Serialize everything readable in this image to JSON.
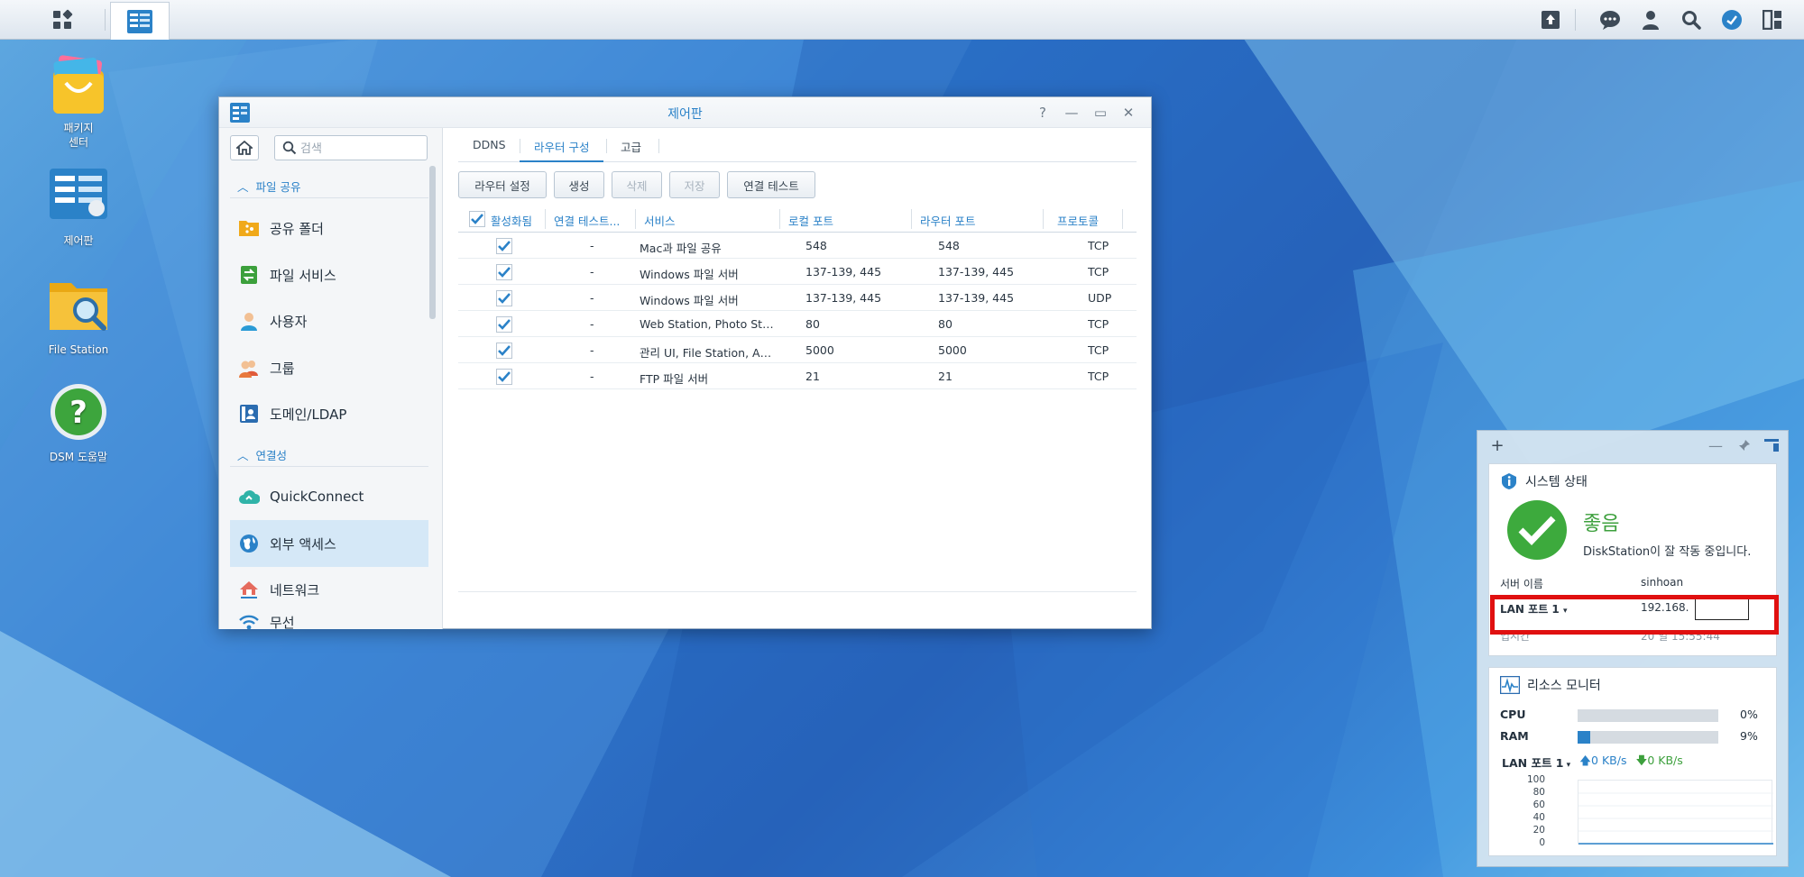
{
  "taskbar": {
    "main_menu_icon": "grid-menu-icon",
    "active_app_icon": "control-panel-icon",
    "right_icons": [
      "upload-icon",
      "chat-icon",
      "user-icon",
      "search-icon",
      "dsm-options-icon",
      "widgets-icon"
    ]
  },
  "desktop": {
    "icons": [
      {
        "label": "패키지\n센터",
        "icon": "package-center-icon"
      },
      {
        "label": "제어판",
        "icon": "control-panel-icon"
      },
      {
        "label": "File Station",
        "icon": "file-station-icon"
      },
      {
        "label": "DSM 도움말",
        "icon": "help-icon"
      }
    ]
  },
  "window": {
    "title": "제어판",
    "controls": {
      "help": "?",
      "minimize": "—",
      "maximize": "▭",
      "close": "✕"
    }
  },
  "sidebar": {
    "search_placeholder": "검색",
    "sections": [
      {
        "label": "파일 공유"
      },
      {
        "label": "연결성"
      }
    ],
    "items": [
      {
        "label": "공유 폴더",
        "icon": "shared-folder-icon"
      },
      {
        "label": "파일 서비스",
        "icon": "file-services-icon"
      },
      {
        "label": "사용자",
        "icon": "user-icon"
      },
      {
        "label": "그룹",
        "icon": "group-icon"
      },
      {
        "label": "도메인/LDAP",
        "icon": "domain-ldap-icon"
      },
      {
        "label": "QuickConnect",
        "icon": "quickconnect-icon"
      },
      {
        "label": "외부 액세스",
        "icon": "external-access-icon"
      },
      {
        "label": "네트워크",
        "icon": "network-icon"
      },
      {
        "label": "무선",
        "icon": "wireless-icon"
      }
    ],
    "active_item": "외부 액세스"
  },
  "tabs": [
    "DDNS",
    "라우터 구성",
    "고급"
  ],
  "active_tab": "라우터 구성",
  "toolbar": {
    "router_settings": "라우터 설정",
    "create": "생성",
    "delete": "삭제",
    "save": "저장",
    "test_connection": "연결 테스트"
  },
  "table": {
    "columns": [
      "활성화됨",
      "연결 테스트...",
      "서비스",
      "로컬 포트",
      "라우터 포트",
      "프로토콜"
    ],
    "rows": [
      {
        "enabled": true,
        "test": "-",
        "service": "Mac과 파일 공유",
        "local_port": "548",
        "router_port": "548",
        "protocol": "TCP"
      },
      {
        "enabled": true,
        "test": "-",
        "service": "Windows 파일 서버",
        "local_port": "137-139, 445",
        "router_port": "137-139, 445",
        "protocol": "TCP"
      },
      {
        "enabled": true,
        "test": "-",
        "service": "Windows 파일 서버",
        "local_port": "137-139, 445",
        "router_port": "137-139, 445",
        "protocol": "UDP"
      },
      {
        "enabled": true,
        "test": "-",
        "service": "Web Station, Photo Statio...",
        "local_port": "80",
        "router_port": "80",
        "protocol": "TCP"
      },
      {
        "enabled": true,
        "test": "-",
        "service": "관리 UI, File Station, Audi...",
        "local_port": "5000",
        "router_port": "5000",
        "protocol": "TCP"
      },
      {
        "enabled": true,
        "test": "-",
        "service": "FTP 파일 서버",
        "local_port": "21",
        "router_port": "21",
        "protocol": "TCP"
      }
    ]
  },
  "widgets": {
    "panel_controls": {
      "add": "+",
      "minimize": "—"
    },
    "system_status": {
      "title": "시스템 상태",
      "status": "좋음",
      "description": "DiskStation이 잘 작동 중입니다.",
      "server_name_label": "서버 이름",
      "server_name": "sinhoan",
      "lan_label": "LAN 포트 1",
      "lan_ip": "192.168.",
      "uptime_label": "업시간",
      "uptime": "20 일 15:55:44"
    },
    "resource_monitor": {
      "title": "리소스 모니터",
      "cpu_label": "CPU",
      "cpu_percent": 0,
      "cpu_text": "0%",
      "ram_label": "RAM",
      "ram_percent": 9,
      "ram_text": "9%",
      "lan_label": "LAN 포트 1",
      "upload": "0 KB/s",
      "download": "0 KB/s",
      "y_ticks": [
        "100",
        "80",
        "60",
        "40",
        "20",
        "0"
      ]
    }
  },
  "colors": {
    "accent": "#2b82c8",
    "good": "#3daa3d",
    "highlight": "#e01010"
  }
}
